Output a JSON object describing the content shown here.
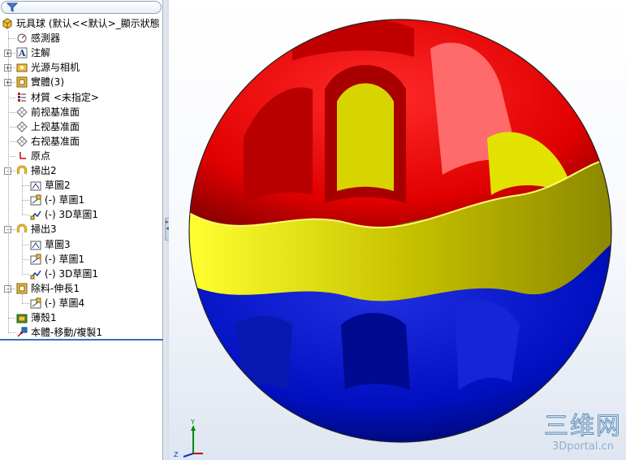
{
  "feature_tree": {
    "filter_icon": "funnel-icon",
    "items": [
      {
        "label": "玩具球 (默认<<默认>_顯示狀態",
        "icon": "part-icon",
        "level": 0,
        "expander": ""
      },
      {
        "label": "感測器",
        "icon": "sensor-icon",
        "level": 1,
        "expander": ""
      },
      {
        "label": "注解",
        "icon": "annotation-icon",
        "level": 1,
        "expander": "+"
      },
      {
        "label": "光源与相机",
        "icon": "lights-camera-icon",
        "level": 1,
        "expander": "+"
      },
      {
        "label": "實體(3)",
        "icon": "solid-bodies-icon",
        "level": 1,
        "expander": "+"
      },
      {
        "label": "材質 <未指定>",
        "icon": "material-icon",
        "level": 1,
        "expander": ""
      },
      {
        "label": "前视基准面",
        "icon": "plane-icon",
        "level": 1,
        "expander": ""
      },
      {
        "label": "上视基准面",
        "icon": "plane-icon",
        "level": 1,
        "expander": ""
      },
      {
        "label": "右视基准面",
        "icon": "plane-icon",
        "level": 1,
        "expander": ""
      },
      {
        "label": "原点",
        "icon": "origin-icon",
        "level": 1,
        "expander": ""
      },
      {
        "label": "掃出2",
        "icon": "sweep-icon",
        "level": 1,
        "expander": "-"
      },
      {
        "label": "草圖2",
        "icon": "sketch-icon",
        "level": 2,
        "expander": ""
      },
      {
        "label": "(-) 草圖1",
        "icon": "sketch-path-icon",
        "level": 2,
        "expander": ""
      },
      {
        "label": "(-) 3D草圖1",
        "icon": "sketch-3d-icon",
        "level": 2,
        "expander": ""
      },
      {
        "label": "掃出3",
        "icon": "sweep-icon",
        "level": 1,
        "expander": "-"
      },
      {
        "label": "草圖3",
        "icon": "sketch-icon",
        "level": 2,
        "expander": ""
      },
      {
        "label": "(-) 草圖1",
        "icon": "sketch-path-icon",
        "level": 2,
        "expander": ""
      },
      {
        "label": "(-) 3D草圖1",
        "icon": "sketch-3d-icon",
        "level": 2,
        "expander": ""
      },
      {
        "label": "除料-伸長1",
        "icon": "extruded-cut-icon",
        "level": 1,
        "expander": "-"
      },
      {
        "label": "(-) 草圖4",
        "icon": "sketch-path-icon",
        "level": 2,
        "expander": ""
      },
      {
        "label": "薄殼1",
        "icon": "shell-icon",
        "level": 1,
        "expander": ""
      },
      {
        "label": "本體-移動/複製1",
        "icon": "move-copy-icon",
        "level": 1,
        "expander": ""
      }
    ]
  },
  "viewport": {
    "model": "toy-ball",
    "triad": {
      "x_label": "X",
      "y_label": "Y",
      "z_label": "Z"
    },
    "colors": {
      "top": "#e00000",
      "band": "#e8e800",
      "bottom": "#0010c0"
    }
  },
  "watermark": {
    "title": "三维网",
    "url": "3Dportal.cn"
  }
}
